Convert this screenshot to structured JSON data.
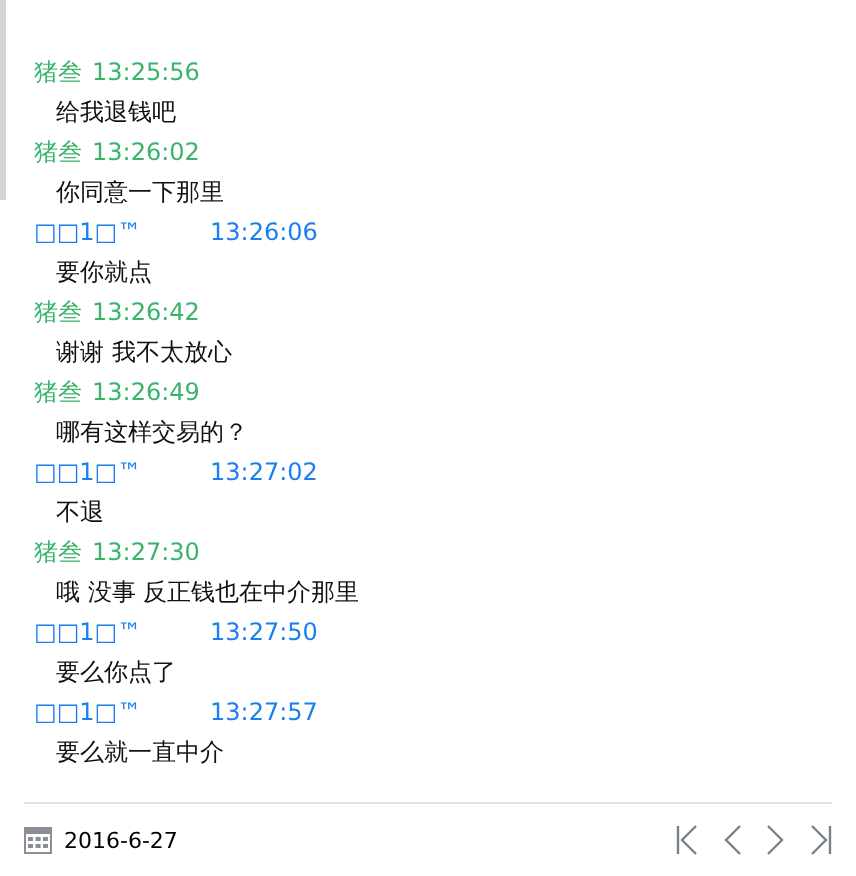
{
  "messages": [
    {
      "kind": "contact",
      "sender": "猪叁",
      "time": "13:25:56",
      "text": "给我退钱吧"
    },
    {
      "kind": "contact",
      "sender": "猪叁",
      "time": "13:26:02",
      "text": "你同意一下那里"
    },
    {
      "kind": "me",
      "sender": "□□1□™",
      "time": "13:26:06",
      "text": "要你就点"
    },
    {
      "kind": "contact",
      "sender": "猪叁",
      "time": "13:26:42",
      "text": "谢谢 我不太放心"
    },
    {
      "kind": "contact",
      "sender": "猪叁",
      "time": "13:26:49",
      "text": "哪有这样交易的？"
    },
    {
      "kind": "me",
      "sender": "□□1□™",
      "time": "13:27:02",
      "text": "不退"
    },
    {
      "kind": "contact",
      "sender": "猪叁",
      "time": "13:27:30",
      "text": "哦 没事  反正钱也在中介那里"
    },
    {
      "kind": "me",
      "sender": "□□1□™",
      "time": "13:27:50",
      "text": "要么你点了"
    },
    {
      "kind": "me",
      "sender": "□□1□™",
      "time": "13:27:57",
      "text": "要么就一直中介"
    }
  ],
  "footer": {
    "date": "2016-6-27"
  }
}
